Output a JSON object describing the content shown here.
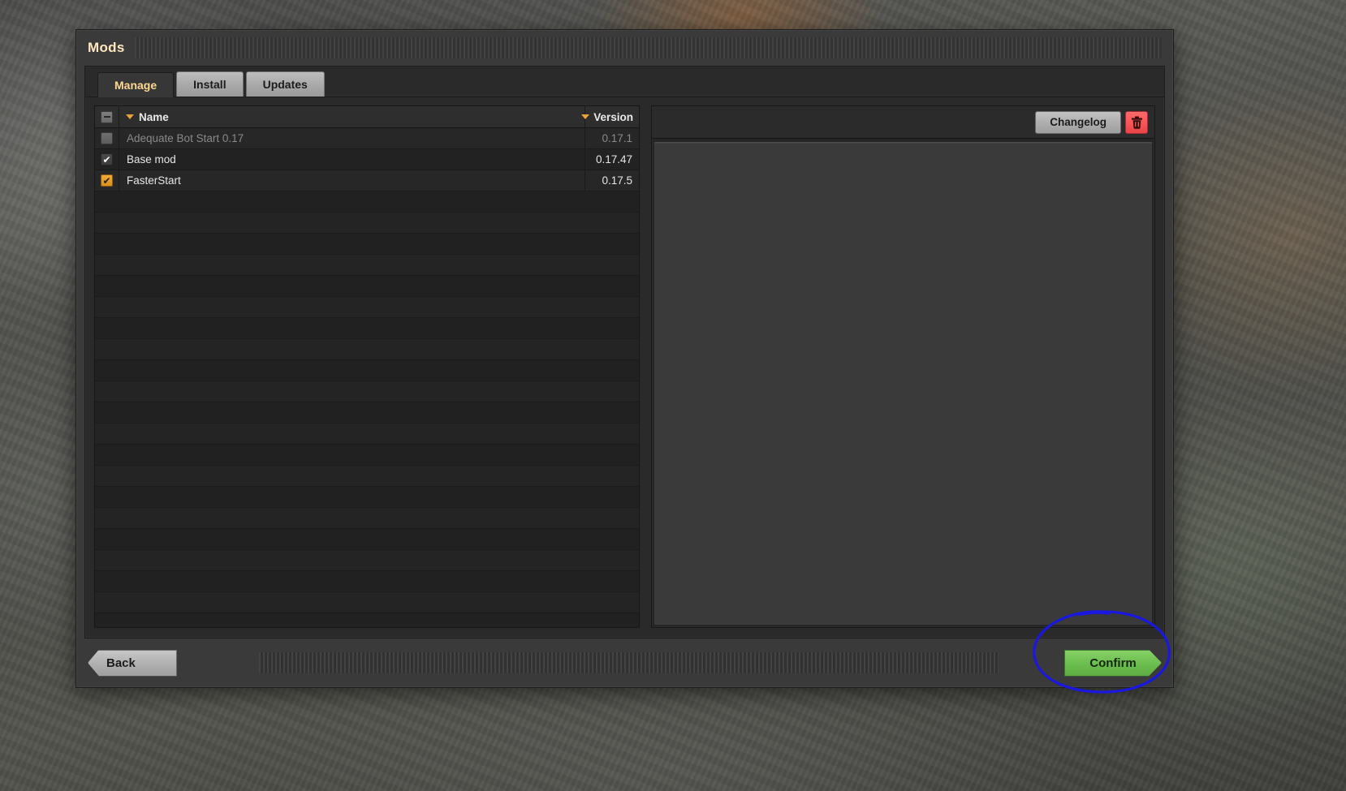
{
  "window": {
    "title": "Mods"
  },
  "tabs": [
    {
      "label": "Manage",
      "active": true
    },
    {
      "label": "Install",
      "active": false
    },
    {
      "label": "Updates",
      "active": false
    }
  ],
  "mod_list": {
    "columns": {
      "check": "select-all",
      "name": "Name",
      "version": "Version"
    },
    "rows": [
      {
        "name": "Adequate Bot Start 0.17",
        "version": "0.17.1",
        "checkbox": "off",
        "enabled": false
      },
      {
        "name": "Base mod",
        "version": "0.17.47",
        "checkbox": "on",
        "enabled": true
      },
      {
        "name": "FasterStart",
        "version": "0.17.5",
        "checkbox": "on-accent",
        "enabled": true
      }
    ],
    "empty_row_count": 23
  },
  "detail_panel": {
    "changelog_label": "Changelog",
    "delete_icon": "trash-icon",
    "content": ""
  },
  "footer": {
    "back_label": "Back",
    "confirm_label": "Confirm"
  },
  "annotation": {
    "shape": "ellipse",
    "color": "#1a18e0",
    "target": "confirm-button"
  },
  "colors": {
    "accent_title": "#ffe6c0",
    "tab_active_text": "#ffd88f",
    "confirm_green": "#6dbe50",
    "delete_red": "#f85656",
    "checkbox_orange": "#e8a33d",
    "window_bg": "#3a3a3a",
    "panel_bg": "#252525"
  }
}
